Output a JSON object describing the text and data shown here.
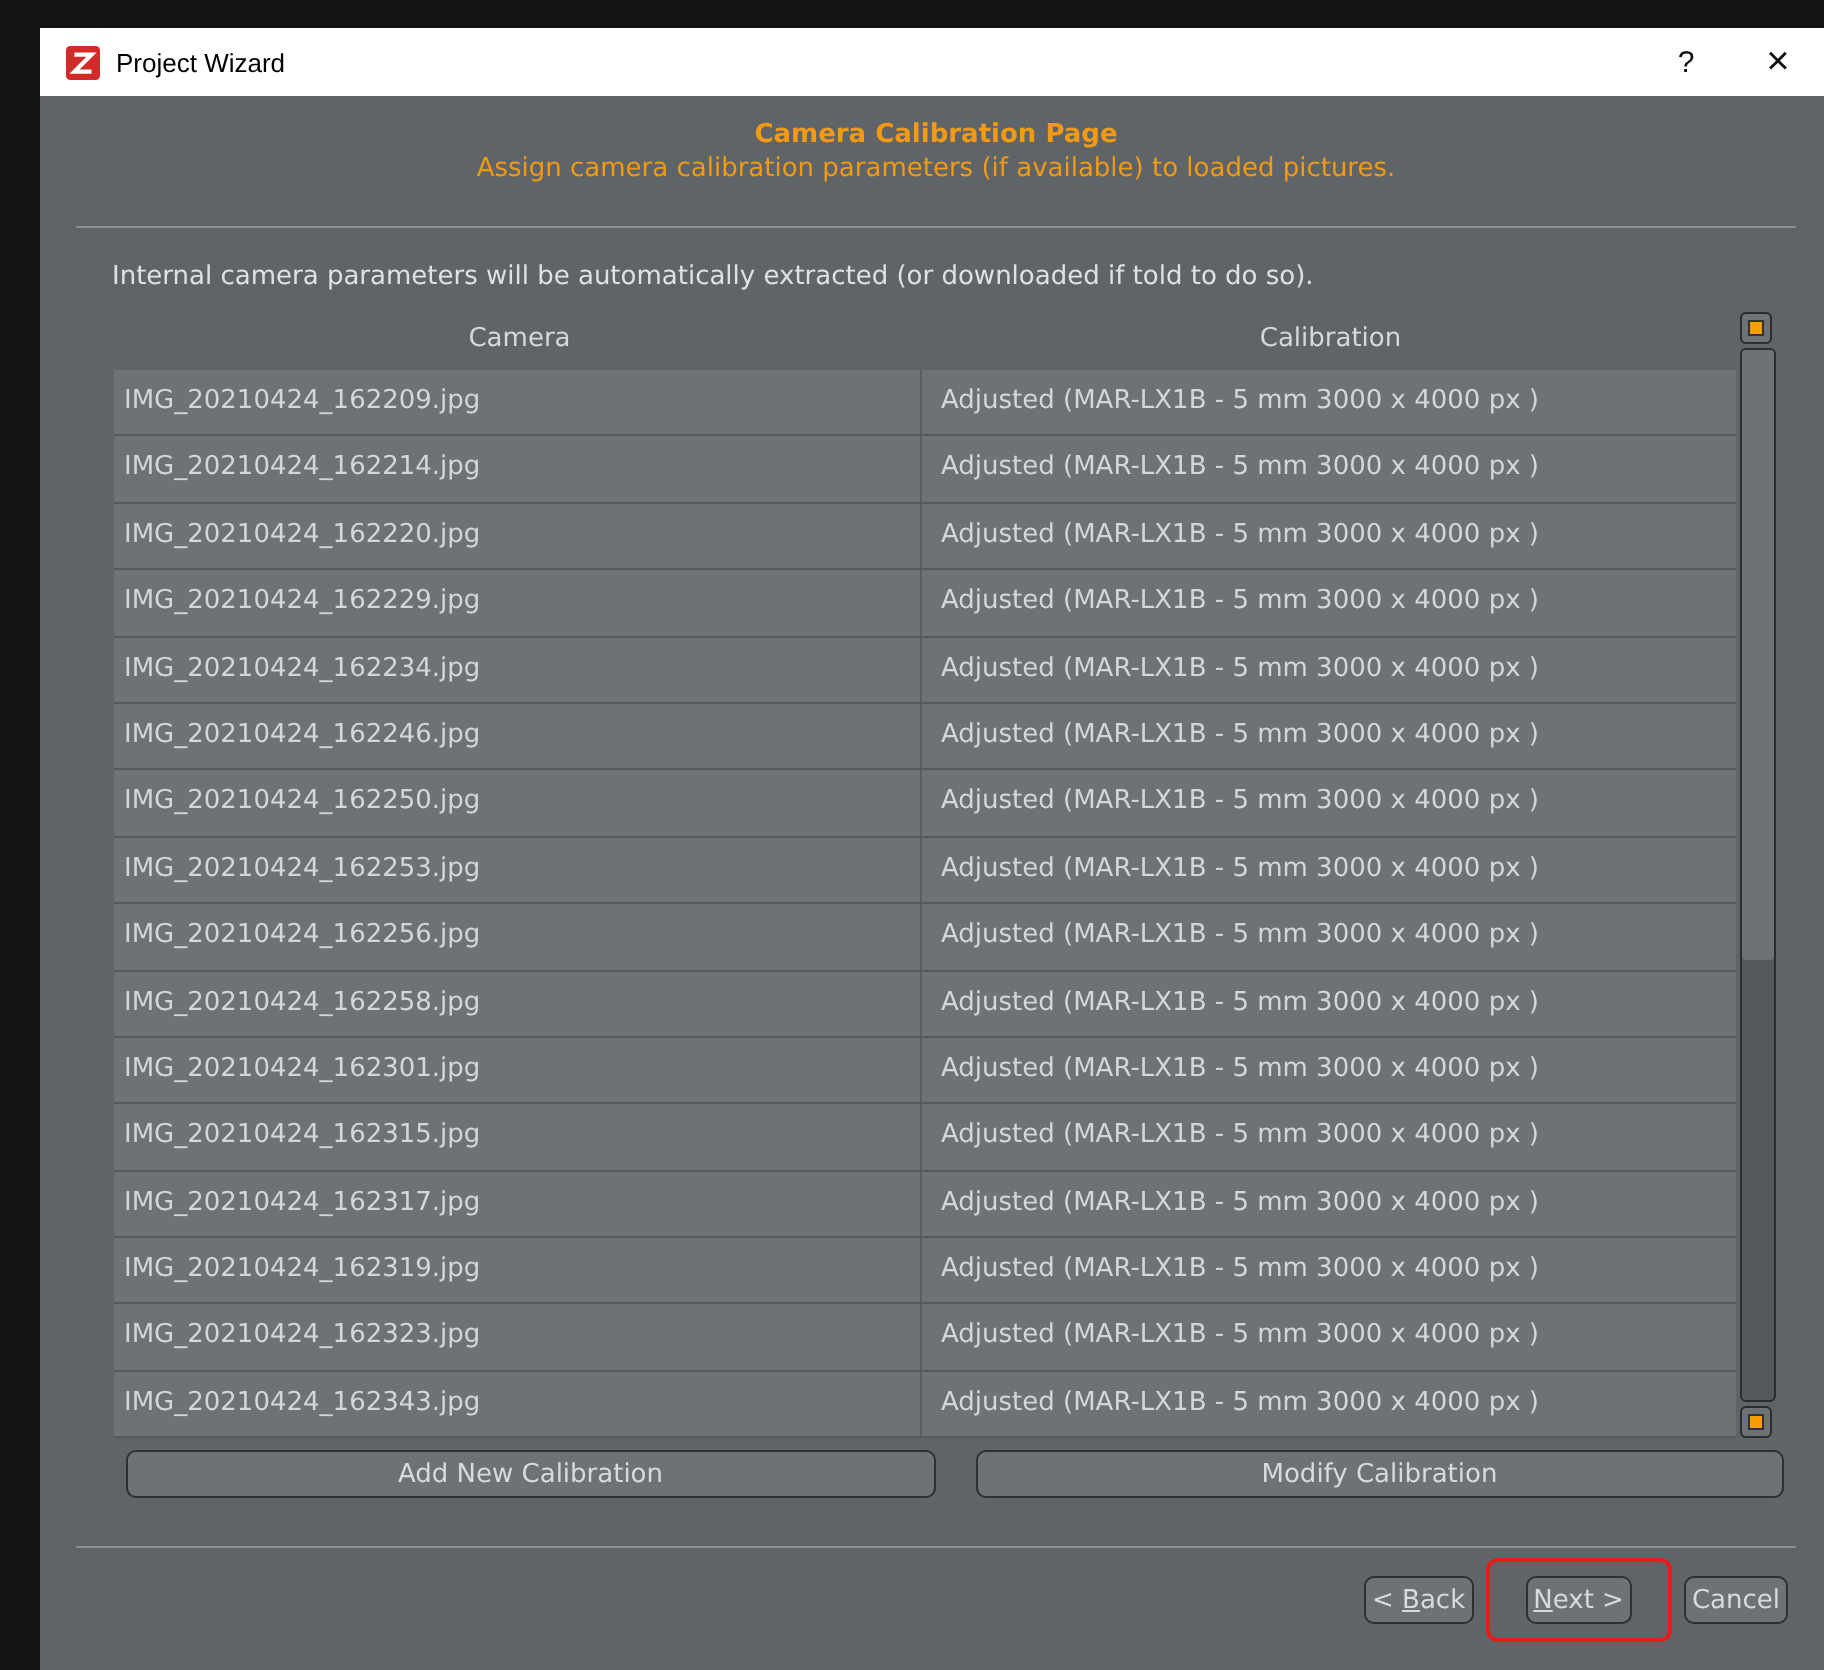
{
  "window": {
    "title": "Project Wizard",
    "help": "?",
    "close": "×"
  },
  "header": {
    "title": "Camera Calibration Page",
    "subtitle": "Assign camera calibration parameters (if available) to loaded pictures."
  },
  "info": "Internal camera parameters will be automatically extracted (or downloaded if told to do so).",
  "table": {
    "columns": [
      "Camera",
      "Calibration"
    ],
    "rows": [
      [
        "IMG_20210424_162209.jpg",
        "Adjusted (MAR-LX1B - 5 mm 3000 x 4000 px )"
      ],
      [
        "IMG_20210424_162214.jpg",
        "Adjusted (MAR-LX1B - 5 mm 3000 x 4000 px )"
      ],
      [
        "IMG_20210424_162220.jpg",
        "Adjusted (MAR-LX1B - 5 mm 3000 x 4000 px )"
      ],
      [
        "IMG_20210424_162229.jpg",
        "Adjusted (MAR-LX1B - 5 mm 3000 x 4000 px )"
      ],
      [
        "IMG_20210424_162234.jpg",
        "Adjusted (MAR-LX1B - 5 mm 3000 x 4000 px )"
      ],
      [
        "IMG_20210424_162246.jpg",
        "Adjusted (MAR-LX1B - 5 mm 3000 x 4000 px )"
      ],
      [
        "IMG_20210424_162250.jpg",
        "Adjusted (MAR-LX1B - 5 mm 3000 x 4000 px )"
      ],
      [
        "IMG_20210424_162253.jpg",
        "Adjusted (MAR-LX1B - 5 mm 3000 x 4000 px )"
      ],
      [
        "IMG_20210424_162256.jpg",
        "Adjusted (MAR-LX1B - 5 mm 3000 x 4000 px )"
      ],
      [
        "IMG_20210424_162258.jpg",
        "Adjusted (MAR-LX1B - 5 mm 3000 x 4000 px )"
      ],
      [
        "IMG_20210424_162301.jpg",
        "Adjusted (MAR-LX1B - 5 mm 3000 x 4000 px )"
      ],
      [
        "IMG_20210424_162315.jpg",
        "Adjusted (MAR-LX1B - 5 mm 3000 x 4000 px )"
      ],
      [
        "IMG_20210424_162317.jpg",
        "Adjusted (MAR-LX1B - 5 mm 3000 x 4000 px )"
      ],
      [
        "IMG_20210424_162319.jpg",
        "Adjusted (MAR-LX1B - 5 mm 3000 x 4000 px )"
      ],
      [
        "IMG_20210424_162323.jpg",
        "Adjusted (MAR-LX1B - 5 mm 3000 x 4000 px )"
      ],
      [
        "IMG_20210424_162343.jpg",
        "Adjusted (MAR-LX1B - 5 mm 3000 x 4000 px )"
      ]
    ]
  },
  "table_buttons": [
    "Add New Calibration",
    "Modify Calibration"
  ],
  "footer_buttons": [
    {
      "before": "< ",
      "mnemonic": "B",
      "after": "ack",
      "highlighted": false
    },
    {
      "mnemonic": "N",
      "after": "ext >",
      "highlighted": true
    },
    {
      "before": "Cancel",
      "highlighted": false
    }
  ]
}
